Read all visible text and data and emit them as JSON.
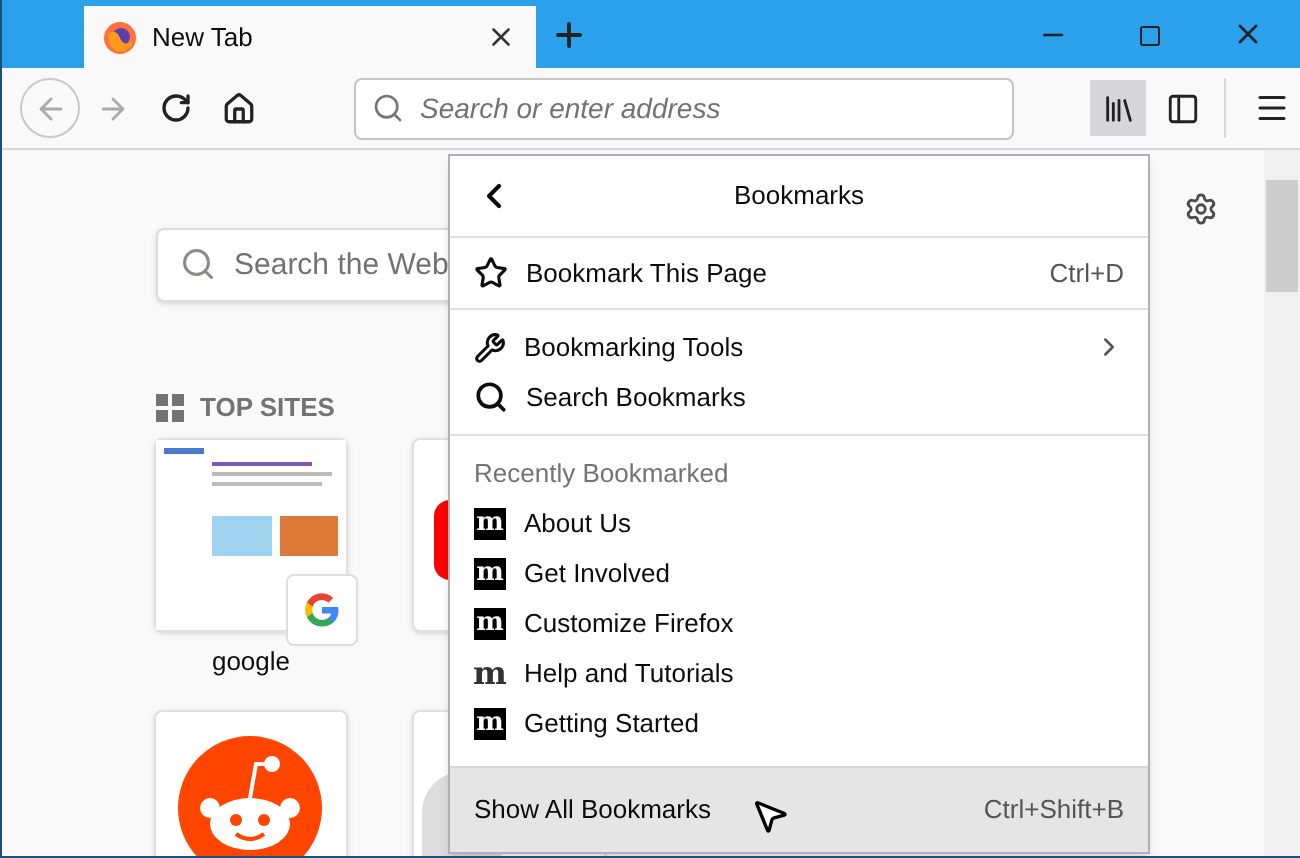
{
  "window": {
    "tab_title": "New Tab"
  },
  "toolbar": {
    "address_placeholder": "Search or enter address",
    "library_selected": true
  },
  "new_tab": {
    "search_placeholder": "Search the Web",
    "top_sites_heading": "TOP SITES",
    "sites": [
      {
        "kind": "screenshot",
        "label": "google"
      },
      {
        "kind": "video"
      },
      {
        "kind": "alien"
      },
      {
        "kind": "round"
      }
    ]
  },
  "bookmarks_panel": {
    "title": "Bookmarks",
    "bookmark_page": {
      "label": "Bookmark This Page",
      "shortcut": "Ctrl+D"
    },
    "tools": [
      {
        "kind": "submenu",
        "label": "Bookmarking Tools"
      },
      {
        "kind": "search",
        "label": "Search Bookmarks"
      }
    ],
    "recent_heading": "Recently Bookmarked",
    "recent": [
      {
        "label": "About Us",
        "icon_letter": "m",
        "kind": "boxed"
      },
      {
        "label": "Get Involved",
        "icon_letter": "m",
        "kind": "boxed"
      },
      {
        "label": "Customize Firefox",
        "icon_letter": "m",
        "kind": "boxed"
      },
      {
        "label": "Help and Tutorials",
        "icon_letter": "m",
        "kind": "plain"
      },
      {
        "label": "Getting Started",
        "icon_letter": "m",
        "kind": "boxed"
      }
    ],
    "show_all": {
      "label": "Show All Bookmarks",
      "shortcut": "Ctrl+Shift+B",
      "hovered": true
    }
  }
}
